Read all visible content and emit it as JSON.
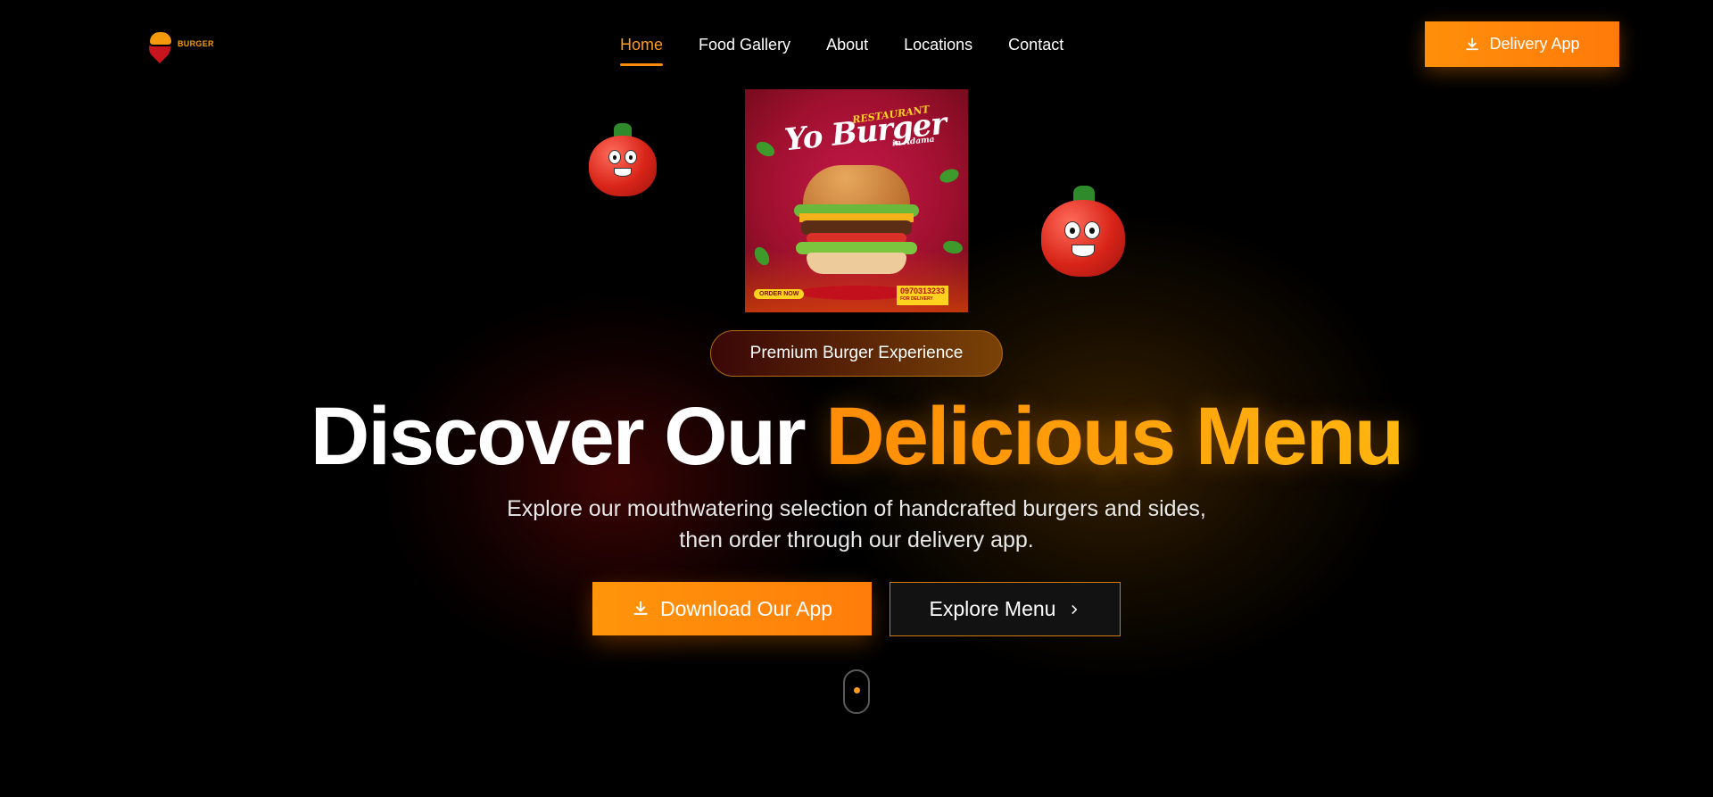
{
  "logo": {
    "text": "BURGER"
  },
  "nav": {
    "items": [
      {
        "label": "Home",
        "active": true
      },
      {
        "label": "Food Gallery"
      },
      {
        "label": "About"
      },
      {
        "label": "Locations"
      },
      {
        "label": "Contact"
      }
    ]
  },
  "header": {
    "delivery_button": "Delivery App",
    "delivery_icon": "download-icon"
  },
  "poster": {
    "subtitle": "RESTAURANT",
    "title": "Yo Burger",
    "tagline": "in Adama",
    "order_label": "ORDER NOW",
    "phone": "0970313233",
    "phone_note": "FOR DELIVERY"
  },
  "hero": {
    "badge": "Premium Burger Experience",
    "headline_plain": "Discover Our ",
    "headline_accent": "Delicious Menu",
    "subtitle": "Explore our mouthwatering selection of handcrafted burgers and sides, then order through our delivery app.",
    "primary_button": "Download Our App",
    "secondary_button": "Explore Menu"
  },
  "colors": {
    "accent": "#ff8c0a",
    "accent_light": "#ffbc12",
    "background": "#000000",
    "active_nav": "#ff9a1a"
  }
}
